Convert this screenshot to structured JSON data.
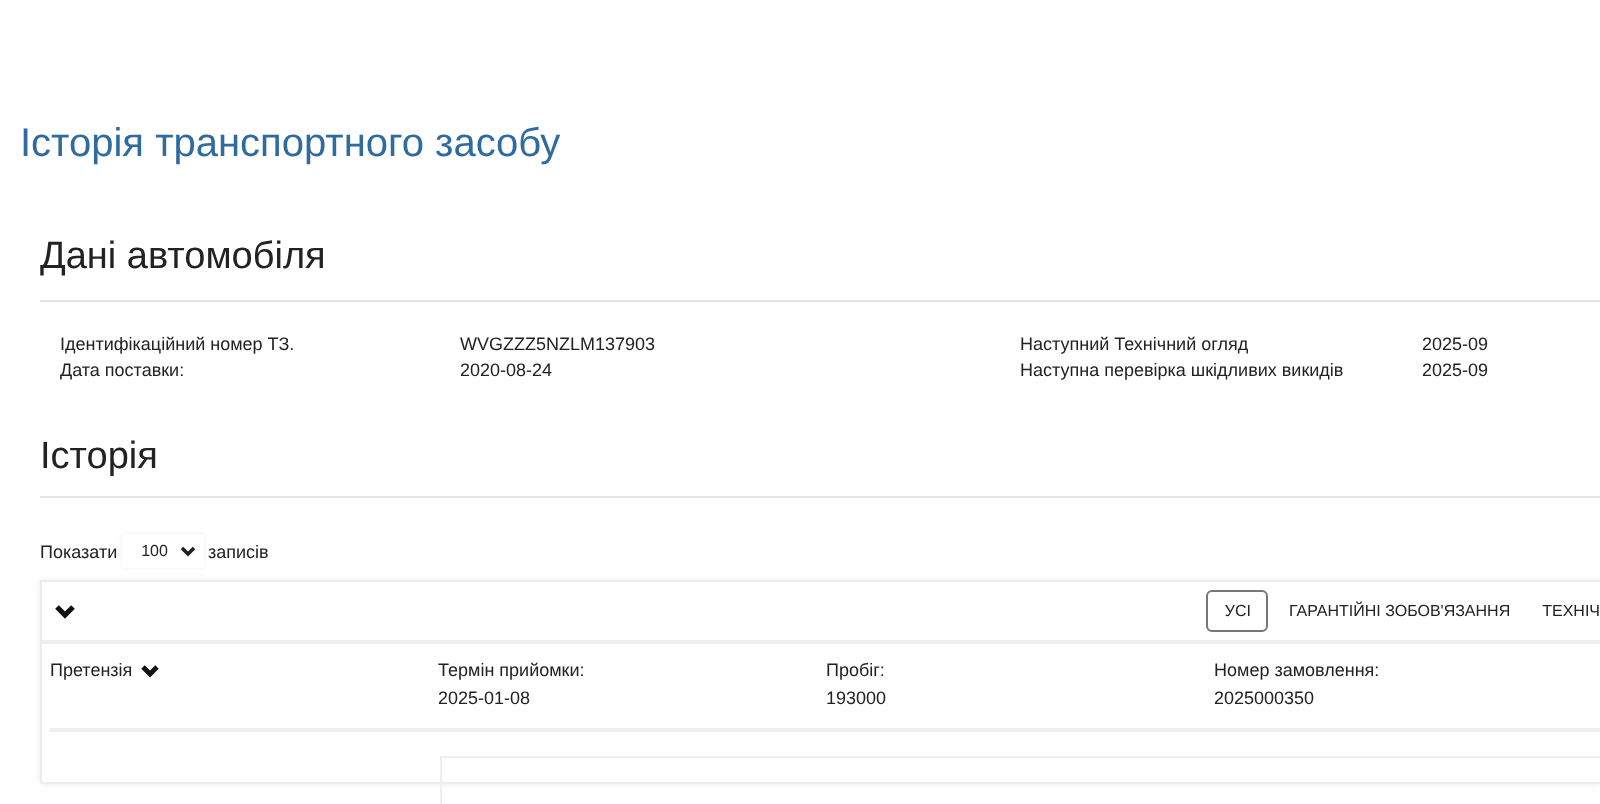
{
  "page_title": "Історія транспортного засобу",
  "vehicle": {
    "heading": "Дані автомобіля",
    "left": [
      {
        "label": "Ідентифікаційний номер ТЗ.",
        "value": "WVGZZZ5NZLM137903"
      },
      {
        "label": "Дата поставки:",
        "value": "2020-08-24"
      }
    ],
    "right": [
      {
        "label": "Наступний Технічний огляд",
        "value": "2025-09"
      },
      {
        "label": "Наступна перевірка шкідливих викидів",
        "value": "2025-09"
      }
    ]
  },
  "history": {
    "heading": "Історія",
    "show_label": "Показати",
    "page_size": "100",
    "records_label": "записів",
    "filters": [
      {
        "label": "УСІ",
        "selected": true
      },
      {
        "label": "ГАРАНТІЙНІ ЗОБОВ'ЯЗАННЯ",
        "selected": false
      },
      {
        "label": "ТЕХНІЧ",
        "selected": false
      }
    ],
    "record": {
      "type": "Претензія",
      "fields": [
        {
          "label": "Термін прийомки:",
          "value": "2025-01-08"
        },
        {
          "label": "Пробіг:",
          "value": "193000"
        },
        {
          "label": "Номер замовлення:",
          "value": "2025000350"
        }
      ]
    }
  }
}
